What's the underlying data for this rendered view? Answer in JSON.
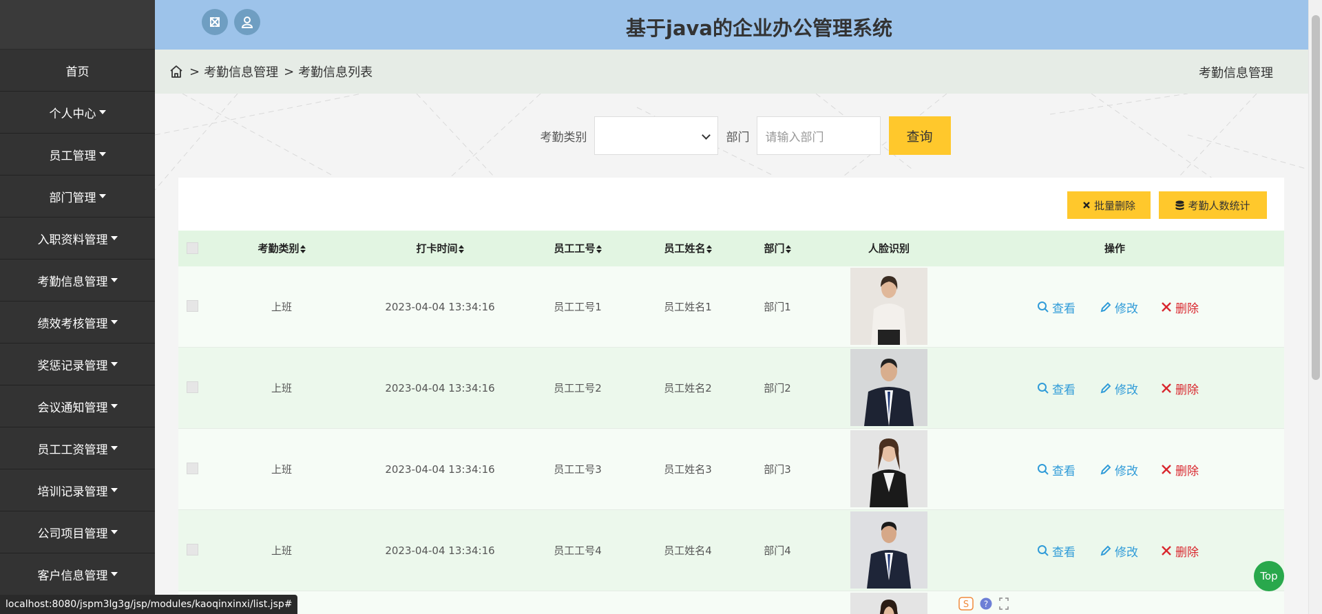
{
  "header": {
    "title": "基于java的企业办公管理系统"
  },
  "sidebar": {
    "items": [
      {
        "label": "首页",
        "dropdown": false
      },
      {
        "label": "个人中心",
        "dropdown": true
      },
      {
        "label": "员工管理",
        "dropdown": true
      },
      {
        "label": "部门管理",
        "dropdown": true
      },
      {
        "label": "入职资料管理",
        "dropdown": true
      },
      {
        "label": "考勤信息管理",
        "dropdown": true
      },
      {
        "label": "绩效考核管理",
        "dropdown": true
      },
      {
        "label": "奖惩记录管理",
        "dropdown": true
      },
      {
        "label": "会议通知管理",
        "dropdown": true
      },
      {
        "label": "员工工资管理",
        "dropdown": true
      },
      {
        "label": "培训记录管理",
        "dropdown": true
      },
      {
        "label": "公司项目管理",
        "dropdown": true
      },
      {
        "label": "客户信息管理",
        "dropdown": true
      }
    ]
  },
  "breadcrumb": {
    "sep": ">",
    "level1": "考勤信息管理",
    "level2": "考勤信息列表",
    "right": "考勤信息管理"
  },
  "search": {
    "type_label": "考勤类别",
    "type_value": "",
    "dept_label": "部门",
    "dept_placeholder": "请输入部门",
    "button": "查询"
  },
  "toolbar": {
    "batch_delete": "批量删除",
    "stats": "考勤人数统计"
  },
  "table": {
    "headers": [
      "考勤类别",
      "打卡时间",
      "员工工号",
      "员工姓名",
      "部门",
      "人脸识别",
      "操作"
    ],
    "actions": {
      "view": "查看",
      "edit": "修改",
      "delete": "删除"
    },
    "rows": [
      {
        "type": "上班",
        "time": "2023-04-04 13:34:16",
        "emp_no": "员工工号1",
        "name": "员工姓名1",
        "dept": "部门1"
      },
      {
        "type": "上班",
        "time": "2023-04-04 13:34:16",
        "emp_no": "员工工号2",
        "name": "员工姓名2",
        "dept": "部门2"
      },
      {
        "type": "上班",
        "time": "2023-04-04 13:34:16",
        "emp_no": "员工工号3",
        "name": "员工姓名3",
        "dept": "部门3"
      },
      {
        "type": "上班",
        "time": "2023-04-04 13:34:16",
        "emp_no": "员工工号4",
        "name": "员工姓名4",
        "dept": "部门4"
      }
    ]
  },
  "status_url": "localhost:8080/jspm3lg3g/jsp/modules/kaoqinxinxi/list.jsp#",
  "top_button": "Top",
  "colors": {
    "header": "#9dc3ea",
    "sidebar": "#333333",
    "accent": "#ffc82c",
    "table_head": "#e2f5e2",
    "delete": "#d9272e",
    "link": "#2f9bd8"
  }
}
